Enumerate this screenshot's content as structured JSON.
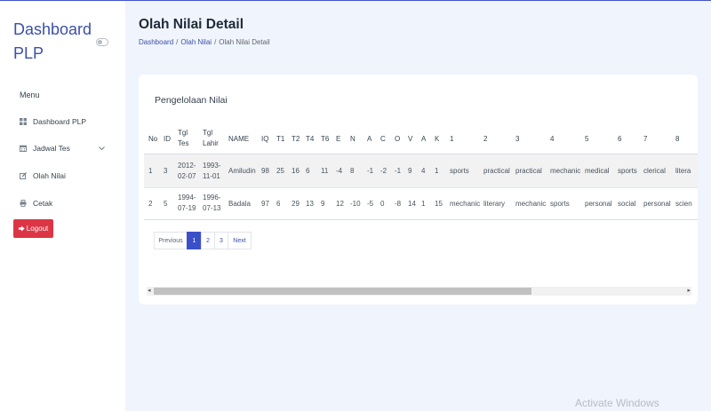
{
  "sidebar": {
    "brand": "Dashboard PLP",
    "menu_title": "Menu",
    "items": [
      {
        "label": "Dashboard PLP",
        "icon": "grid-icon"
      },
      {
        "label": "Jadwal Tes",
        "icon": "calendar-icon",
        "has_submenu": true
      },
      {
        "label": "Olah Nilai",
        "icon": "edit-icon"
      },
      {
        "label": "Cetak",
        "icon": "printer-icon"
      }
    ],
    "logout_label": "Logout"
  },
  "header": {
    "title": "Olah Nilai Detail",
    "breadcrumb": [
      "Dashboard",
      "Olah Nilai",
      "Olah Nilai Detail"
    ]
  },
  "card": {
    "title": "Pengelolaan Nilai",
    "table": {
      "columns": [
        "No",
        "ID",
        "Tgl Tes",
        "Tgl Lahir",
        "NAME",
        "IQ",
        "T1",
        "T2",
        "T4",
        "T6",
        "E",
        "N",
        "A",
        "C",
        "O",
        "V",
        "A",
        "K",
        "1",
        "2",
        "3",
        "4",
        "5",
        "6",
        "7",
        "8"
      ],
      "rows": [
        [
          "1",
          "3",
          "2012-02-07",
          "1993-11-01",
          "Amiludin",
          "98",
          "25",
          "16",
          "6",
          "11",
          "-4",
          "8",
          "-1",
          "-2",
          "-1",
          "9",
          "4",
          "1",
          "sports",
          "practical",
          "practical",
          "mechanic",
          "medical",
          "sports",
          "clerical",
          "litera"
        ],
        [
          "2",
          "5",
          "1994-07-19",
          "1996-07-13",
          "Badala",
          "97",
          "6",
          "29",
          "13",
          "9",
          "12",
          "-10",
          "-5",
          "0",
          "-8",
          "14",
          "1",
          "15",
          "mechanic",
          "literary",
          "mechanic",
          "sports",
          "personal",
          "social",
          "personal",
          "scien"
        ]
      ]
    },
    "pagination": {
      "previous": "Previous",
      "pages": [
        "1",
        "2",
        "3"
      ],
      "current_page": "1",
      "next": "Next"
    }
  },
  "watermark": "Activate Windows",
  "colors": {
    "accent": "#3b50c8",
    "brand_text": "#3b50a8",
    "logout": "#dc3545",
    "background": "#f0f4fc"
  }
}
